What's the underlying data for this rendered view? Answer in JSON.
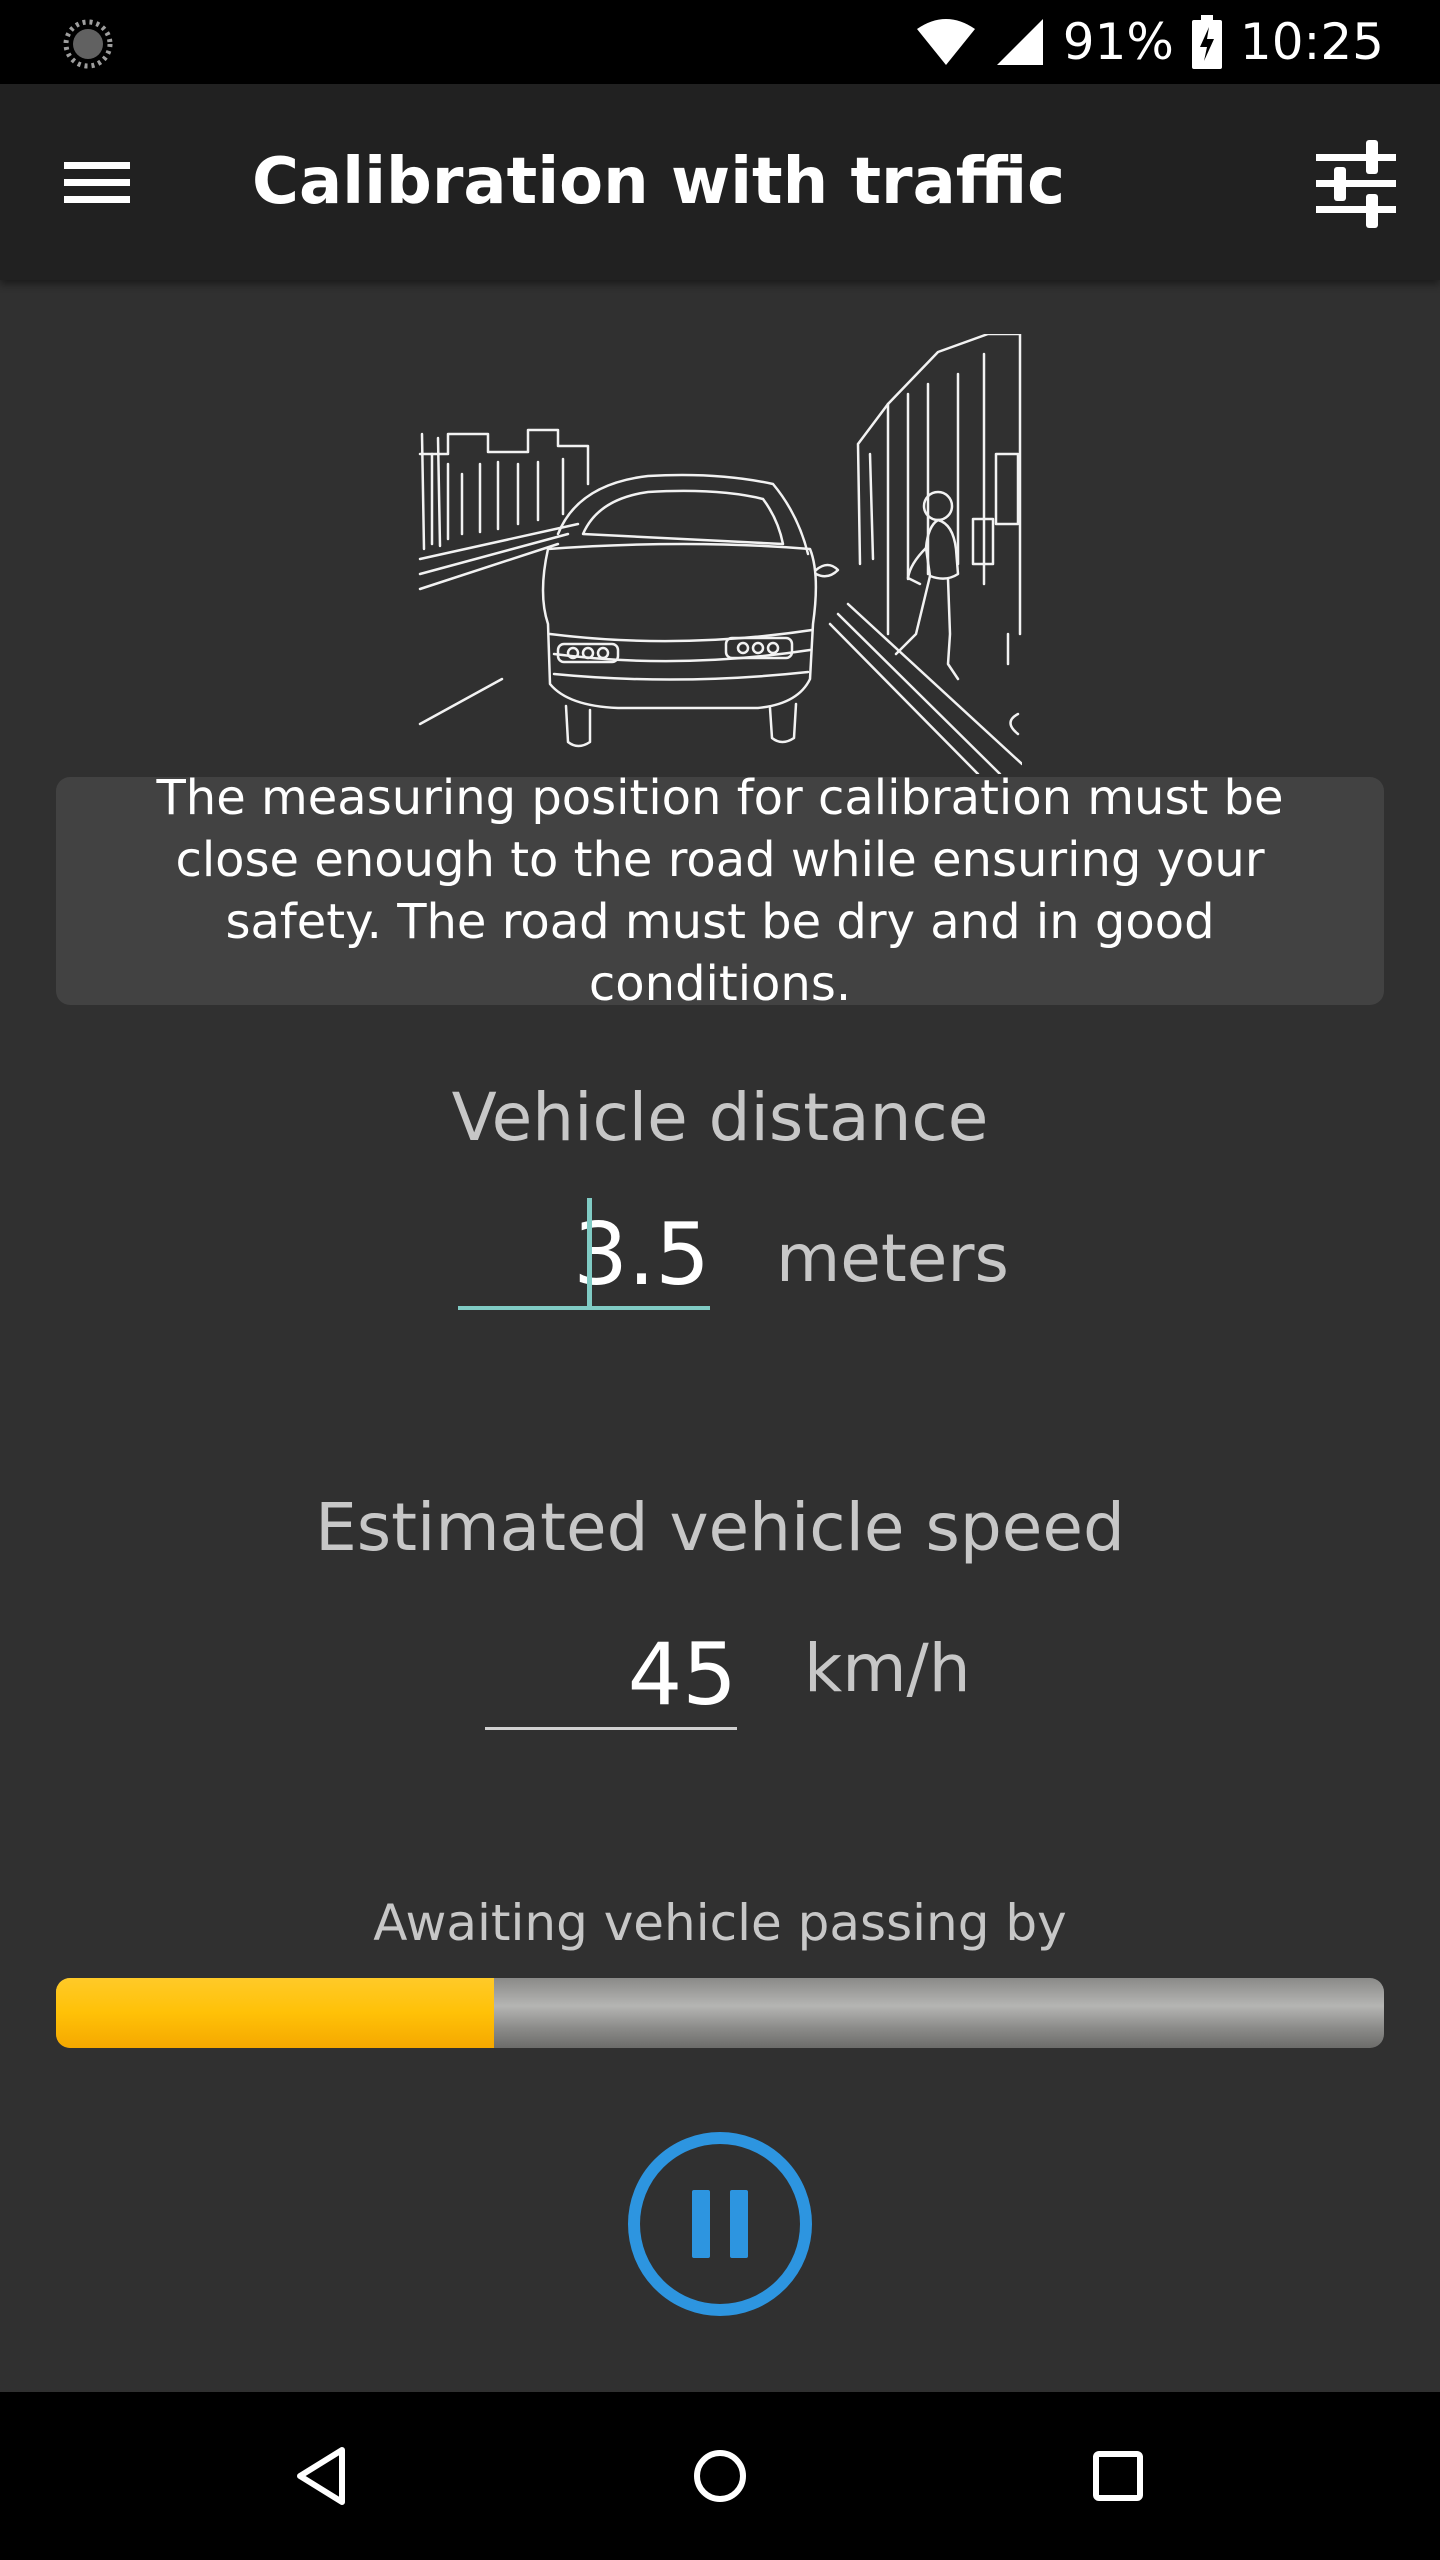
{
  "status_bar": {
    "battery": "91%",
    "time": "10:25",
    "icons": [
      "loading-icon",
      "wifi-icon",
      "cell-signal-icon",
      "battery-charging-icon"
    ]
  },
  "app_bar": {
    "title": "Calibration with traffic",
    "left_icon": "menu-icon",
    "right_icon": "tune-icon"
  },
  "info": {
    "text": "The measuring position for calibration must be close enough to the road while ensuring your safety. The road must be dry and in good conditions."
  },
  "distance": {
    "label": "Vehicle distance",
    "value": "3.5",
    "unit": "meters"
  },
  "speed": {
    "label": "Estimated vehicle speed",
    "value": "45",
    "unit": "km/h"
  },
  "progress": {
    "label": "Awaiting vehicle passing by",
    "fraction": 0.33
  },
  "colors": {
    "accent_teal": "#80cbc4",
    "progress_yellow": "#ffc107",
    "pause_blue": "#2d95e0",
    "background": "#303030",
    "app_bar": "#212121",
    "card": "#424242"
  },
  "controls": {
    "pause_icon": "pause-icon"
  },
  "nav_bar": {
    "icons": [
      "back-icon",
      "home-icon",
      "recents-icon"
    ]
  }
}
